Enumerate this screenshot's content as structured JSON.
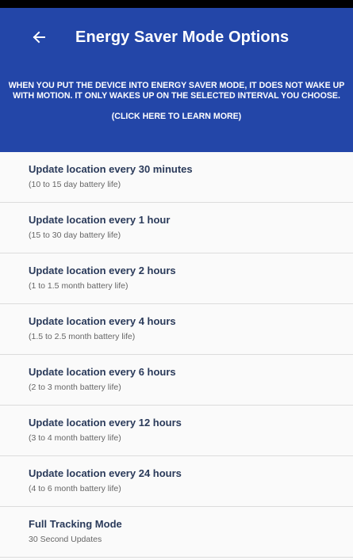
{
  "header": {
    "title": "Energy Saver Mode Options",
    "back_icon": "arrow-back-icon"
  },
  "banner": {
    "message": "WHEN YOU PUT THE DEVICE INTO ENERGY SAVER MODE, IT DOES NOT WAKE UP WITH MOTION. IT ONLY WAKES UP ON THE SELECTED INTERVAL YOU CHOOSE.",
    "learn_more": "(CLICK HERE TO LEARN MORE)"
  },
  "options": [
    {
      "title": "Update location every 30 minutes",
      "subtitle": "(10 to 15 day battery life)"
    },
    {
      "title": "Update location every 1 hour",
      "subtitle": "(15 to 30 day battery life)"
    },
    {
      "title": "Update location every 2 hours",
      "subtitle": "(1 to 1.5 month battery life)"
    },
    {
      "title": "Update location every 4 hours",
      "subtitle": "(1.5 to 2.5 month battery life)"
    },
    {
      "title": "Update location every 6 hours",
      "subtitle": "(2 to 3 month battery life)"
    },
    {
      "title": "Update location every 12 hours",
      "subtitle": "(3 to 4 month battery life)"
    },
    {
      "title": "Update location every 24 hours",
      "subtitle": "(4 to 6 month battery life)"
    },
    {
      "title": "Full Tracking Mode",
      "subtitle": "30 Second Updates"
    }
  ],
  "colors": {
    "primary": "#2346a8",
    "title_text": "#2a3a5a",
    "divider": "#dcdcdc"
  }
}
